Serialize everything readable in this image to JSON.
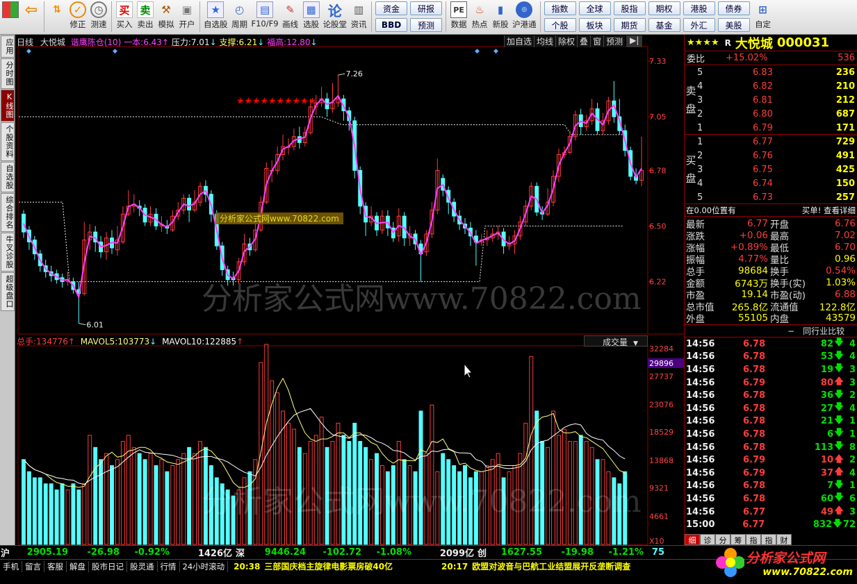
{
  "toolbar": {
    "main": [
      {
        "name": "menu-grid",
        "label": "",
        "icon": "grid-icon"
      },
      {
        "name": "back",
        "label": "",
        "icon": "back-arrow-icon"
      },
      {
        "name": "updown",
        "label": "",
        "icon": "updown-arrow-icon"
      },
      {
        "name": "xiuzheng",
        "label": "修正",
        "icon": "revise-icon"
      },
      {
        "name": "cesu",
        "label": "测速",
        "icon": "speed-icon"
      },
      {
        "name": "buy",
        "label": "买入",
        "icon": "buy-icon",
        "glyph": "买"
      },
      {
        "name": "sell",
        "label": "卖出",
        "icon": "sell-icon",
        "glyph": "卖"
      },
      {
        "name": "moni",
        "label": "模拟",
        "icon": "hammer-icon"
      },
      {
        "name": "kaihu",
        "label": "开户",
        "icon": "lock-icon"
      },
      {
        "name": "zixuangu",
        "label": "自选股",
        "icon": "star-icon"
      },
      {
        "name": "zhouqi",
        "label": "周期",
        "icon": "clock-icon"
      },
      {
        "name": "f10",
        "label": "F10/F9",
        "icon": "f10-icon"
      },
      {
        "name": "huaxian",
        "label": "画线",
        "icon": "pen-icon"
      },
      {
        "name": "xuangu",
        "label": "选股",
        "icon": "screen-icon"
      },
      {
        "name": "lunguntang",
        "label": "论股堂",
        "icon": "discuss-icon",
        "glyph": "论"
      },
      {
        "name": "zixun",
        "label": "资讯",
        "icon": "info-icon"
      }
    ],
    "pair1": [
      "资金",
      "BBD"
    ],
    "pair2": [
      "研报",
      "预测"
    ],
    "main2": [
      {
        "name": "shuju",
        "label": "数据",
        "icon": "pe-icon",
        "glyph": "PE"
      },
      {
        "name": "redian",
        "label": "热点",
        "icon": "hot-icon"
      },
      {
        "name": "xingu",
        "label": "新股",
        "icon": "ipo-icon"
      },
      {
        "name": "hugangtong",
        "label": "沪港通",
        "icon": "hk-connect-icon"
      }
    ],
    "grid": [
      [
        "指数",
        "全球",
        "股指",
        "期权",
        "港股",
        "债券"
      ],
      [
        "个股",
        "板块",
        "期货",
        "基金",
        "外汇",
        "美股"
      ]
    ],
    "last": {
      "label": "自定",
      "icon": "custom-icon"
    }
  },
  "sidebar": [
    "应用",
    "分时图",
    "K线图",
    "个股资料",
    "自选股",
    "综合排名",
    "牛叉诊股",
    "超级盘口"
  ],
  "sidebar_active": 2,
  "kheader": {
    "period": "日线",
    "stock": "大悦城",
    "indicator": "谐鹰陈仓(10)",
    "yiben_label": "一本:",
    "yiben": "6.43",
    "yaliv_label": "压力:",
    "yali": "7.01",
    "zhicheng_label": "支撑:",
    "zhicheng": "6.21",
    "fugao_label": "福高:",
    "fugao": "12.80"
  },
  "kbuttons": [
    "加自选",
    "均线",
    "除权",
    "叠",
    "窗",
    "预测"
  ],
  "kprice_axis": [
    "7.33",
    "7.05",
    "6.78",
    "6.50",
    "6.22"
  ],
  "kmarks": {
    "high": "7.26",
    "low": "6.01"
  },
  "watermark": "分析家公式网www.70822.com",
  "watermark_small": "分析家公式网www.70822.com",
  "vheader": {
    "total_label": "总手:",
    "total": "134776",
    "mavol5_label": "MAVOL5:",
    "mavol5": "103773",
    "mavol10_label": "MAVOL10:",
    "mavol10": "122885",
    "dropdown": "成交量"
  },
  "vaxis": [
    "32284",
    "29896",
    "27737",
    "23076",
    "18529",
    "13868",
    "9321",
    "4661",
    "X10"
  ],
  "chart_data": {
    "type": "candlestick",
    "candles": [
      [
        6.56,
        6.47,
        6.58,
        6.44
      ],
      [
        6.48,
        6.42,
        6.5,
        6.38
      ],
      [
        6.43,
        6.36,
        6.45,
        6.33
      ],
      [
        6.36,
        6.3,
        6.38,
        6.27
      ],
      [
        6.3,
        6.27,
        6.33,
        6.24
      ],
      [
        6.27,
        6.25,
        6.3,
        6.22
      ],
      [
        6.26,
        6.23,
        6.28,
        6.21
      ],
      [
        6.24,
        6.22,
        6.26,
        6.19
      ],
      [
        6.22,
        6.23,
        6.27,
        6.2
      ],
      [
        6.22,
        6.18,
        6.24,
        6.16
      ],
      [
        6.18,
        6.16,
        6.22,
        6.01
      ],
      [
        6.16,
        6.43,
        6.52,
        6.15
      ],
      [
        6.43,
        6.47,
        6.51,
        6.38
      ],
      [
        6.47,
        6.42,
        6.5,
        6.37
      ],
      [
        6.42,
        6.37,
        6.45,
        6.34
      ],
      [
        6.37,
        6.44,
        6.47,
        6.33
      ],
      [
        6.44,
        6.39,
        6.48,
        6.36
      ],
      [
        6.38,
        6.43,
        6.5,
        6.35
      ],
      [
        6.42,
        6.56,
        6.6,
        6.41
      ],
      [
        6.56,
        6.6,
        6.68,
        6.55
      ],
      [
        6.6,
        6.61,
        6.66,
        6.57
      ],
      [
        6.6,
        6.59,
        6.63,
        6.55
      ],
      [
        6.59,
        6.52,
        6.61,
        6.5
      ],
      [
        6.52,
        6.56,
        6.6,
        6.5
      ],
      [
        6.56,
        6.5,
        6.59,
        6.48
      ],
      [
        6.5,
        6.51,
        6.55,
        6.47
      ],
      [
        6.5,
        6.49,
        6.53,
        6.46
      ],
      [
        6.48,
        6.55,
        6.58,
        6.47
      ],
      [
        6.55,
        6.58,
        6.62,
        6.53
      ],
      [
        6.58,
        6.64,
        6.66,
        6.56
      ],
      [
        6.64,
        6.58,
        6.66,
        6.52
      ],
      [
        6.58,
        6.62,
        6.68,
        6.57
      ],
      [
        6.62,
        6.7,
        6.72,
        6.6
      ],
      [
        6.7,
        6.66,
        6.73,
        6.62
      ],
      [
        6.66,
        6.56,
        6.68,
        6.52
      ],
      [
        6.56,
        6.4,
        6.58,
        6.38
      ],
      [
        6.4,
        6.28,
        6.42,
        6.25
      ],
      [
        6.28,
        6.23,
        6.3,
        6.2
      ],
      [
        6.24,
        6.23,
        6.27,
        6.2
      ],
      [
        6.23,
        6.32,
        6.34,
        6.21
      ],
      [
        6.32,
        6.41,
        6.46,
        6.3
      ],
      [
        6.41,
        6.38,
        6.44,
        6.35
      ],
      [
        6.38,
        6.48,
        6.51,
        6.37
      ],
      [
        6.48,
        6.62,
        6.65,
        6.47
      ],
      [
        6.62,
        6.79,
        6.82,
        6.61
      ],
      [
        6.78,
        6.78,
        6.83,
        6.72
      ],
      [
        6.78,
        6.86,
        6.9,
        6.76
      ],
      [
        6.86,
        6.9,
        6.96,
        6.83
      ],
      [
        6.9,
        6.9,
        6.94,
        6.86
      ],
      [
        6.9,
        6.95,
        6.99,
        6.88
      ],
      [
        6.95,
        6.92,
        7.0,
        6.89
      ],
      [
        6.92,
        6.97,
        7.0,
        6.9
      ],
      [
        6.97,
        7.1,
        7.14,
        6.96
      ],
      [
        7.1,
        7.12,
        7.16,
        7.06
      ],
      [
        7.12,
        7.14,
        7.2,
        7.1
      ],
      [
        7.14,
        7.09,
        7.17,
        7.05
      ],
      [
        7.09,
        7.12,
        7.22,
        7.07
      ],
      [
        7.12,
        7.14,
        7.26,
        7.1
      ],
      [
        7.14,
        7.08,
        7.16,
        7.03
      ],
      [
        7.08,
        7.03,
        7.1,
        6.98
      ],
      [
        7.03,
        6.78,
        7.05,
        6.74
      ],
      [
        6.78,
        6.6,
        6.8,
        6.56
      ],
      [
        6.6,
        6.52,
        6.62,
        6.45
      ],
      [
        6.52,
        6.55,
        6.6,
        6.5
      ],
      [
        6.55,
        6.48,
        6.57,
        6.45
      ],
      [
        6.48,
        6.55,
        6.58,
        6.46
      ],
      [
        6.55,
        6.49,
        6.58,
        6.45
      ],
      [
        6.49,
        6.44,
        6.52,
        6.42
      ],
      [
        6.45,
        6.55,
        6.59,
        6.42
      ],
      [
        6.55,
        6.44,
        6.57,
        6.4
      ],
      [
        6.44,
        6.46,
        6.5,
        6.4
      ],
      [
        6.46,
        6.41,
        6.48,
        6.38
      ],
      [
        6.41,
        6.36,
        6.43,
        6.22
      ],
      [
        6.37,
        6.46,
        6.48,
        6.35
      ],
      [
        6.46,
        6.58,
        6.62,
        6.44
      ],
      [
        6.58,
        6.78,
        6.84,
        6.56
      ],
      [
        6.74,
        6.68,
        6.76,
        6.65
      ],
      [
        6.68,
        6.62,
        6.7,
        6.56
      ],
      [
        6.62,
        6.55,
        6.64,
        6.52
      ],
      [
        6.55,
        6.51,
        6.58,
        6.48
      ],
      [
        6.51,
        6.49,
        6.54,
        6.46
      ],
      [
        6.49,
        6.45,
        6.52,
        6.4
      ],
      [
        6.45,
        6.42,
        6.48,
        6.3
      ],
      [
        6.42,
        6.43,
        6.46,
        6.4
      ],
      [
        6.43,
        6.44,
        6.48,
        6.4
      ],
      [
        6.44,
        6.46,
        6.49,
        6.42
      ],
      [
        6.46,
        6.47,
        6.5,
        6.43
      ],
      [
        6.47,
        6.4,
        6.49,
        6.36
      ],
      [
        6.4,
        6.41,
        6.45,
        6.38
      ],
      [
        6.41,
        6.45,
        6.48,
        6.36
      ],
      [
        6.45,
        6.52,
        6.55,
        6.43
      ],
      [
        6.52,
        6.6,
        6.63,
        6.5
      ],
      [
        6.6,
        6.7,
        6.72,
        6.58
      ],
      [
        6.7,
        6.57,
        6.72,
        6.55
      ],
      [
        6.57,
        6.56,
        6.6,
        6.53
      ],
      [
        6.56,
        6.62,
        6.69,
        6.55
      ],
      [
        6.62,
        6.75,
        6.78,
        6.6
      ],
      [
        6.75,
        6.86,
        6.89,
        6.72
      ],
      [
        6.86,
        6.87,
        6.9,
        6.84
      ],
      [
        6.87,
        6.95,
        6.98,
        6.86
      ],
      [
        6.95,
        7.06,
        7.08,
        6.93
      ],
      [
        7.06,
        7.0,
        7.09,
        6.96
      ],
      [
        7.0,
        7.03,
        7.06,
        6.98
      ],
      [
        7.03,
        7.09,
        7.14,
        7.01
      ],
      [
        7.09,
        6.98,
        7.12,
        6.96
      ],
      [
        6.98,
        7.03,
        7.07,
        6.96
      ],
      [
        7.03,
        7.13,
        7.15,
        7.01
      ],
      [
        7.13,
        7.05,
        7.23,
        7.02
      ],
      [
        7.05,
        6.98,
        7.14,
        6.96
      ],
      [
        6.98,
        6.88,
        7.01,
        6.85
      ],
      [
        6.88,
        6.75,
        6.9,
        6.73
      ],
      [
        6.75,
        6.73,
        6.79,
        6.71
      ],
      [
        6.73,
        6.78,
        6.95,
        6.7
      ]
    ],
    "volumes": [
      14,
      12,
      11,
      11,
      10,
      10,
      9,
      10,
      9,
      10,
      9,
      10,
      18,
      16,
      14,
      15,
      13,
      14,
      17,
      18,
      16,
      15,
      14,
      15,
      13,
      14,
      12,
      13,
      14,
      15,
      16,
      15,
      17,
      16,
      13,
      11,
      10,
      9,
      8,
      9,
      11,
      12,
      14,
      30,
      33,
      27,
      25,
      22,
      20,
      19,
      16,
      15,
      17,
      18,
      21,
      16,
      17,
      20,
      18,
      17,
      20,
      17,
      16,
      14,
      15,
      13,
      12,
      13,
      17,
      14,
      13,
      12,
      22,
      15,
      23,
      12,
      15,
      14,
      13,
      12,
      13,
      11,
      12,
      12,
      13,
      14,
      15,
      11,
      12,
      13,
      15,
      20,
      31,
      22,
      17,
      16,
      22,
      18,
      19,
      17,
      17,
      18,
      17,
      16,
      14,
      14,
      12,
      11,
      10,
      12
    ],
    "mavol5_color": "#ffff80",
    "mavol10_color": "#ffffff"
  },
  "quote": {
    "rating": "★★★★",
    "r_tag": "R",
    "name": "大悦城",
    "code": "000031",
    "weibi_label": "委比",
    "weibi": "+15.02%",
    "weicha": "536",
    "sell_label": [
      "卖",
      "盘"
    ],
    "buy_label": [
      "买",
      "盘"
    ],
    "asks": [
      [
        "5",
        "6.83",
        "236"
      ],
      [
        "4",
        "6.82",
        "210"
      ],
      [
        "3",
        "6.81",
        "212"
      ],
      [
        "2",
        "6.80",
        "687"
      ],
      [
        "1",
        "6.79",
        "171"
      ]
    ],
    "bids": [
      [
        "1",
        "6.77",
        "729"
      ],
      [
        "2",
        "6.76",
        "491"
      ],
      [
        "3",
        "6.75",
        "425"
      ],
      [
        "4",
        "6.74",
        "150"
      ],
      [
        "5",
        "6.73",
        "257"
      ]
    ],
    "position_text": "在0.00位置有",
    "buy_text": "买单! 查看详细",
    "stats": [
      [
        "最新",
        "6.77",
        "开盘",
        "6.76"
      ],
      [
        "涨跌",
        "+0.06",
        "最高",
        "7.02"
      ],
      [
        "涨幅",
        "+0.89%",
        "最低",
        "6.70"
      ],
      [
        "振幅",
        "4.77%",
        "量比",
        "0.96"
      ],
      [
        "总手",
        "98684",
        "换手",
        "0.54%"
      ],
      [
        "金额",
        "6743万",
        "换手(实)",
        "1.03%"
      ],
      [
        "市盈",
        "19.14",
        "市盈(动)",
        "6.88"
      ],
      [
        "总市值",
        "265.8亿",
        "流通值",
        "122.8亿"
      ],
      [
        "外盘",
        "55105",
        "内盘",
        "43579"
      ]
    ],
    "industry_btn": "同行业比较",
    "ticks": [
      [
        "14:56",
        "6.78",
        "82",
        "down",
        "4"
      ],
      [
        "14:56",
        "6.78",
        "53",
        "down",
        "4"
      ],
      [
        "14:56",
        "6.78",
        "19",
        "down",
        "3"
      ],
      [
        "14:56",
        "6.79",
        "80",
        "up",
        "3"
      ],
      [
        "14:56",
        "6.78",
        "36",
        "down",
        "2"
      ],
      [
        "14:56",
        "6.78",
        "27",
        "down",
        "4"
      ],
      [
        "14:56",
        "6.78",
        "21",
        "down",
        "1"
      ],
      [
        "14:56",
        "6.78",
        "6",
        "down",
        "1"
      ],
      [
        "14:56",
        "6.78",
        "113",
        "down",
        "8"
      ],
      [
        "14:56",
        "6.79",
        "10",
        "up",
        "2"
      ],
      [
        "14:56",
        "6.79",
        "37",
        "up",
        "4"
      ],
      [
        "14:56",
        "6.78",
        "7",
        "down",
        "1"
      ],
      [
        "14:56",
        "6.78",
        "60",
        "down",
        "6"
      ],
      [
        "14:56",
        "6.77",
        "49",
        "up",
        "3"
      ],
      [
        "15:00",
        "6.77",
        "832",
        "down",
        "72"
      ]
    ],
    "tabs": [
      "细",
      "诊",
      "分",
      "筹",
      "指",
      "指",
      "财"
    ]
  },
  "status": {
    "sh_label": "沪",
    "sh": "2905.19",
    "sh_chg": "-26.98",
    "sh_pct": "-0.92%",
    "sh_amt": "1426亿",
    "sz_label": "深",
    "sz": "9446.24",
    "sz_chg": "-102.72",
    "sz_pct": "-1.08%",
    "sz_amt": "2099亿",
    "cy_label": "创",
    "cy": "1627.55",
    "cy_chg": "-19.98",
    "cy_pct": "-1.21%",
    "extra": "75"
  },
  "bottom_tabs": [
    "手机",
    "留言",
    "客服",
    "解盘",
    "股市日记",
    "股灵通",
    "行情",
    "24小时滚动"
  ],
  "news": [
    {
      "time": "20:38",
      "text": "三部国庆档主旋律电影票房破40亿"
    },
    {
      "time": "20:17",
      "text": "欧盟对波音与巴航工业结盟展开反垄断调查"
    }
  ],
  "logo": {
    "text": "分析家公式网",
    "url": "www.70822.com"
  }
}
